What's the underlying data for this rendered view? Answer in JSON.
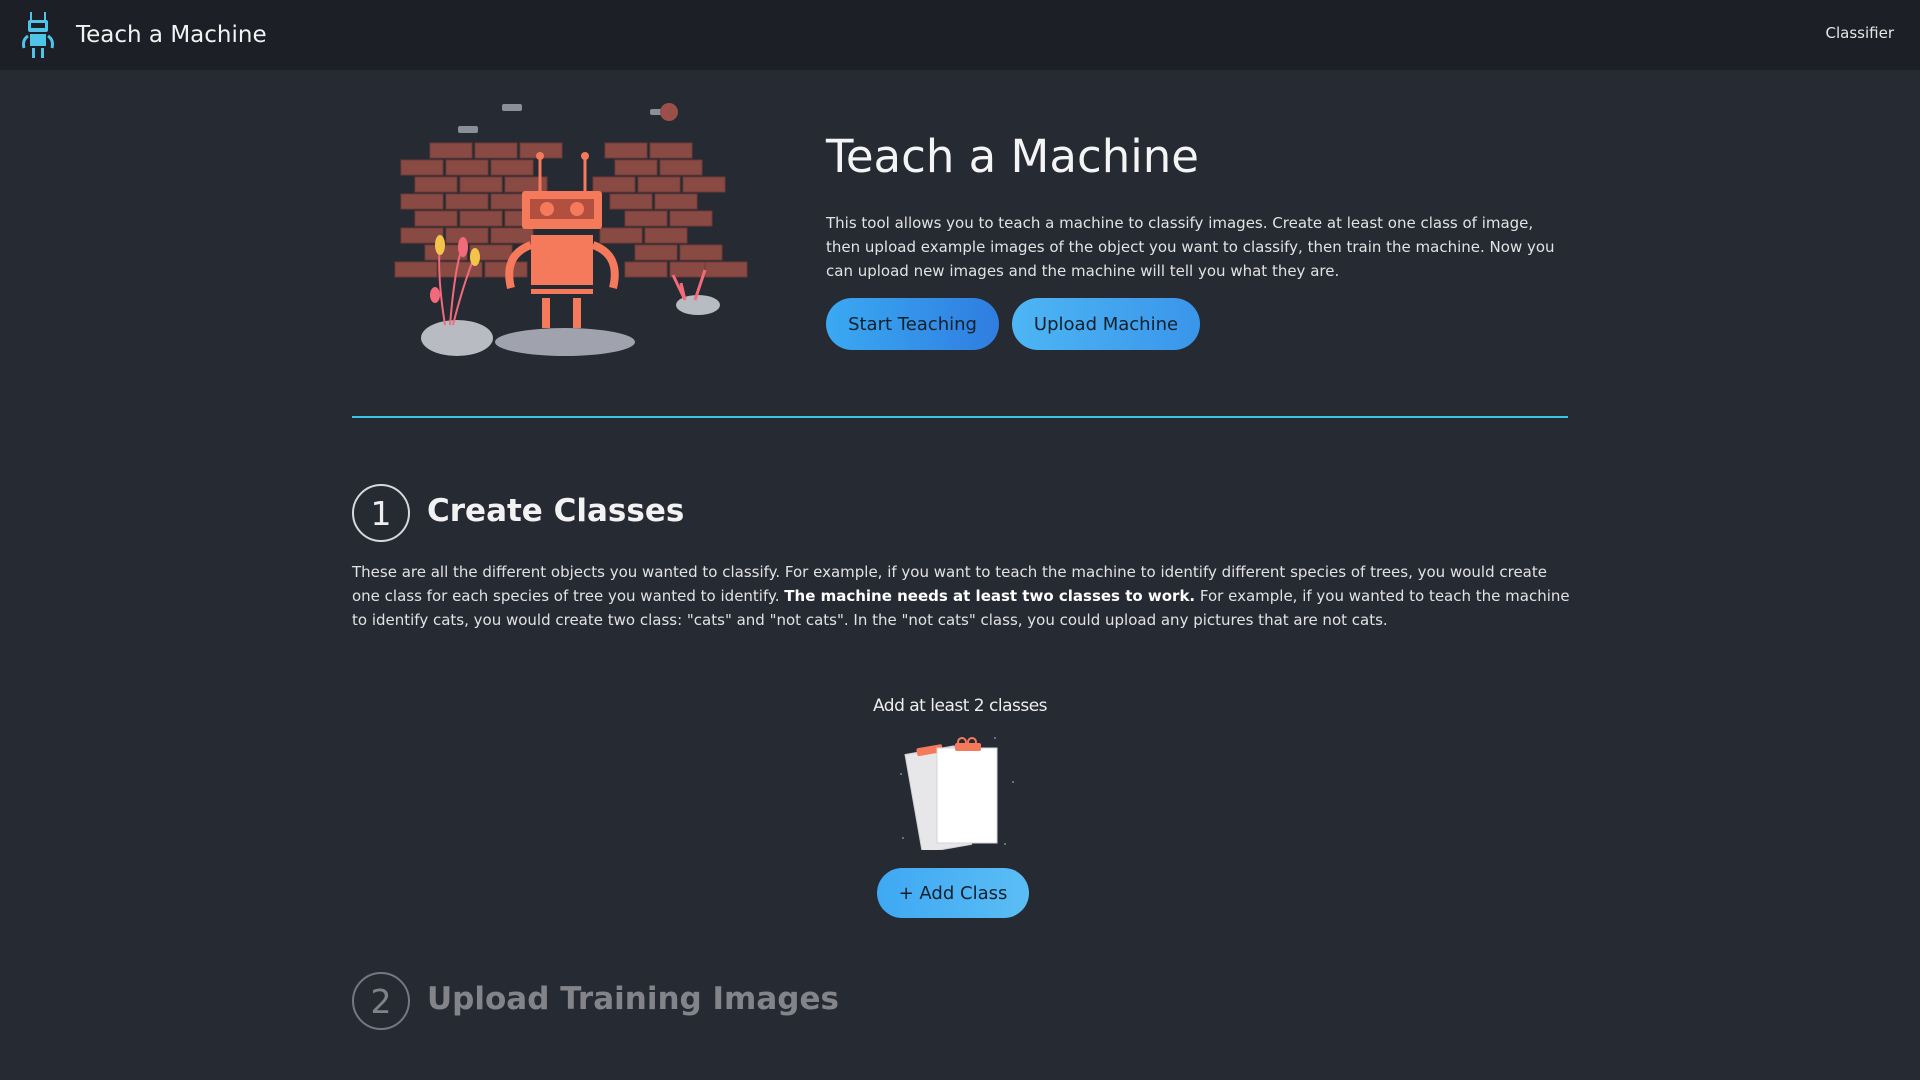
{
  "navbar": {
    "logo_icon": "robot-icon",
    "title": "Teach a Machine",
    "link_label": "Classifier"
  },
  "hero": {
    "illustration": "robot-brick-wall-illustration",
    "title": "Teach a Machine",
    "description": "This tool allows you to teach a machine to classify images. Create at least one class of image, then upload example images of the object you want to classify, then train the machine. Now you can upload new images and the machine will tell you what they are.",
    "start_button": "Start Teaching",
    "upload_button": "Upload Machine"
  },
  "steps": [
    {
      "number": "1",
      "title": "Create Classes",
      "desc_part1": "These are all the different objects you wanted to classify. For example, if you want to teach the machine to identify different species of trees, you would create one class for each species of tree you wanted to identify. ",
      "desc_bold": "The machine needs at least two classes to work.",
      "desc_part2": " For example, if you wanted to teach the machine to identify cats, you would create two class: \"cats\" and \"not cats\". In the \"not cats\" class, you could upload any pictures that are not cats.",
      "hint": "Add at least 2 classes",
      "hint_icon": "clipboard-icon",
      "add_button": "+ Add Class"
    },
    {
      "number": "2",
      "title": "Upload Training Images"
    }
  ],
  "colors": {
    "background": "#262a33",
    "navbar": "#1c1f25",
    "accent": "#3cc3e6",
    "robot": "#f57a5c",
    "brick": "#8a4a44"
  }
}
